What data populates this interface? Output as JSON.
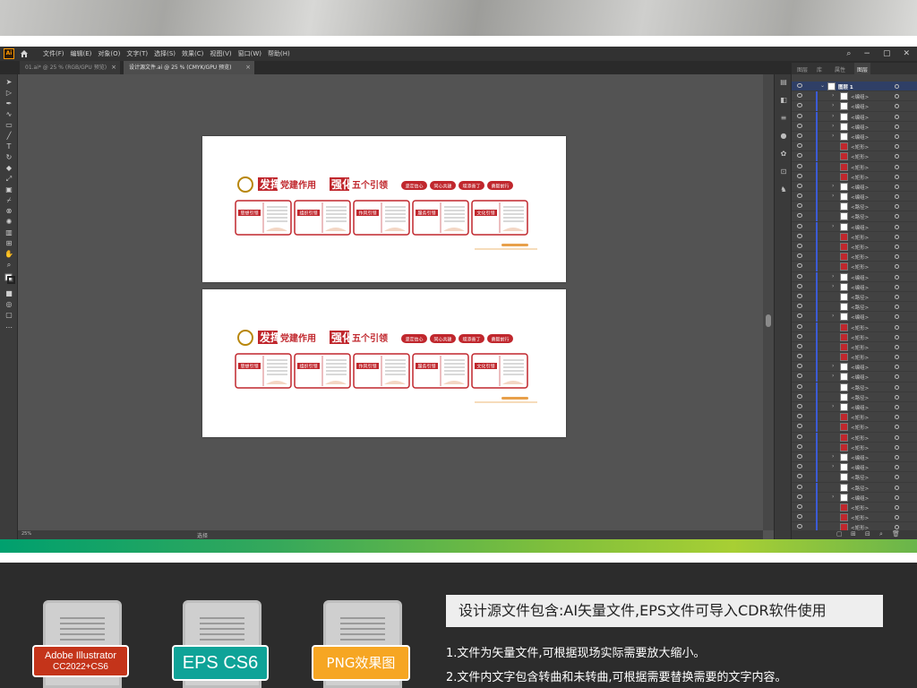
{
  "app": {
    "logo_text": "Ai",
    "menu": [
      "文件(F)",
      "编辑(E)",
      "对象(O)",
      "文字(T)",
      "选择(S)",
      "效果(C)",
      "视图(V)",
      "窗口(W)",
      "帮助(H)"
    ],
    "window_controls": [
      "−",
      "▢",
      "✕"
    ]
  },
  "tabs": [
    {
      "label": "01.ai* @ 25 % (RGB/GPU 预览)",
      "close": "×"
    },
    {
      "label": "设计源文件.ai @ 25 % (CMYK/GPU 预览)",
      "close": "×"
    }
  ],
  "status": {
    "zoom": "25%",
    "mode": "选择"
  },
  "layers_panel": {
    "tabs": [
      "图层",
      "库",
      "属性",
      "图层"
    ],
    "active_tab": 3,
    "top_layer": "图层 1",
    "rows": [
      {
        "name": "<编组>",
        "thumb": "white",
        "expand": true
      },
      {
        "name": "<编组>",
        "thumb": "white",
        "expand": true
      },
      {
        "name": "<编组>",
        "thumb": "white",
        "expand": true
      },
      {
        "name": "<编组>",
        "thumb": "white",
        "expand": true
      },
      {
        "name": "<编组>",
        "thumb": "white",
        "expand": true
      },
      {
        "name": "<矩形>",
        "thumb": "red",
        "expand": false
      },
      {
        "name": "<矩形>",
        "thumb": "red",
        "expand": false
      },
      {
        "name": "<矩形>",
        "thumb": "red",
        "expand": false
      },
      {
        "name": "<矩形>",
        "thumb": "red",
        "expand": false
      },
      {
        "name": "<编组>",
        "thumb": "white",
        "expand": true
      },
      {
        "name": "<编组>",
        "thumb": "white",
        "expand": true
      },
      {
        "name": "<路径>",
        "thumb": "white",
        "expand": false
      },
      {
        "name": "<路径>",
        "thumb": "white",
        "expand": false
      },
      {
        "name": "<编组>",
        "thumb": "white",
        "expand": true
      },
      {
        "name": "<矩形>",
        "thumb": "red",
        "expand": false
      },
      {
        "name": "<矩形>",
        "thumb": "red",
        "expand": false
      },
      {
        "name": "<矩形>",
        "thumb": "red",
        "expand": false
      },
      {
        "name": "<矩形>",
        "thumb": "red",
        "expand": false
      },
      {
        "name": "<编组>",
        "thumb": "white",
        "expand": true
      },
      {
        "name": "<编组>",
        "thumb": "white",
        "expand": true
      },
      {
        "name": "<路径>",
        "thumb": "white",
        "expand": false
      },
      {
        "name": "<路径>",
        "thumb": "white",
        "expand": false
      },
      {
        "name": "<编组>",
        "thumb": "white",
        "expand": true
      },
      {
        "name": "<矩形>",
        "thumb": "red",
        "expand": false
      },
      {
        "name": "<矩形>",
        "thumb": "red",
        "expand": false
      },
      {
        "name": "<矩形>",
        "thumb": "red",
        "expand": false
      },
      {
        "name": "<矩形>",
        "thumb": "red",
        "expand": false
      },
      {
        "name": "<编组>",
        "thumb": "white",
        "expand": true
      },
      {
        "name": "<编组>",
        "thumb": "white",
        "expand": true
      },
      {
        "name": "<路径>",
        "thumb": "white",
        "expand": false
      },
      {
        "name": "<路径>",
        "thumb": "white",
        "expand": false
      },
      {
        "name": "<编组>",
        "thumb": "white",
        "expand": true
      },
      {
        "name": "<矩形>",
        "thumb": "red",
        "expand": false
      },
      {
        "name": "<矩形>",
        "thumb": "red",
        "expand": false
      },
      {
        "name": "<矩形>",
        "thumb": "red",
        "expand": false
      },
      {
        "name": "<矩形>",
        "thumb": "red",
        "expand": false
      },
      {
        "name": "<编组>",
        "thumb": "white",
        "expand": true
      },
      {
        "name": "<编组>",
        "thumb": "white",
        "expand": true
      },
      {
        "name": "<路径>",
        "thumb": "white",
        "expand": false
      },
      {
        "name": "<路径>",
        "thumb": "white",
        "expand": false
      },
      {
        "name": "<编组>",
        "thumb": "white",
        "expand": true
      },
      {
        "name": "<矩形>",
        "thumb": "red",
        "expand": false
      },
      {
        "name": "<矩形>",
        "thumb": "red",
        "expand": false
      },
      {
        "name": "<矩形>",
        "thumb": "red",
        "expand": false
      },
      {
        "name": "<编组>",
        "thumb": "white",
        "expand": true
      }
    ]
  },
  "design": {
    "title_left_hl": "发挥",
    "title_left": "党建作用",
    "title_right_hl": "强化",
    "title_right": "五个引领",
    "pills": [
      "坚定信心",
      "同心共建",
      "增添善丁",
      "勇毅前行"
    ],
    "cards": [
      "思想引领",
      "组织引领",
      "作风引领",
      "服务引领",
      "文化引领"
    ],
    "brand_red": "#c0272d",
    "accent_orange": "#e8a04a"
  },
  "promo": {
    "badges": {
      "ai_line1": "Adobe Illustrator",
      "ai_line2": "CC2022+CS6",
      "eps": "EPS CS6",
      "png": "PNG效果图"
    },
    "badge_colors": {
      "ai": "#c4341a",
      "eps": "#0fa398",
      "png": "#f6a623"
    },
    "headline": "设计源文件包含:AI矢量文件,EPS文件可导入CDR软件使用",
    "line1": "1.文件为矢量文件,可根据现场实际需要放大缩小。",
    "line2": "2.文件内文字包含转曲和未转曲,可根据需要替换需要的文字内容。"
  },
  "gradient_colors": [
    "#00a06e",
    "#7fbf3c",
    "#a8cf34"
  ]
}
